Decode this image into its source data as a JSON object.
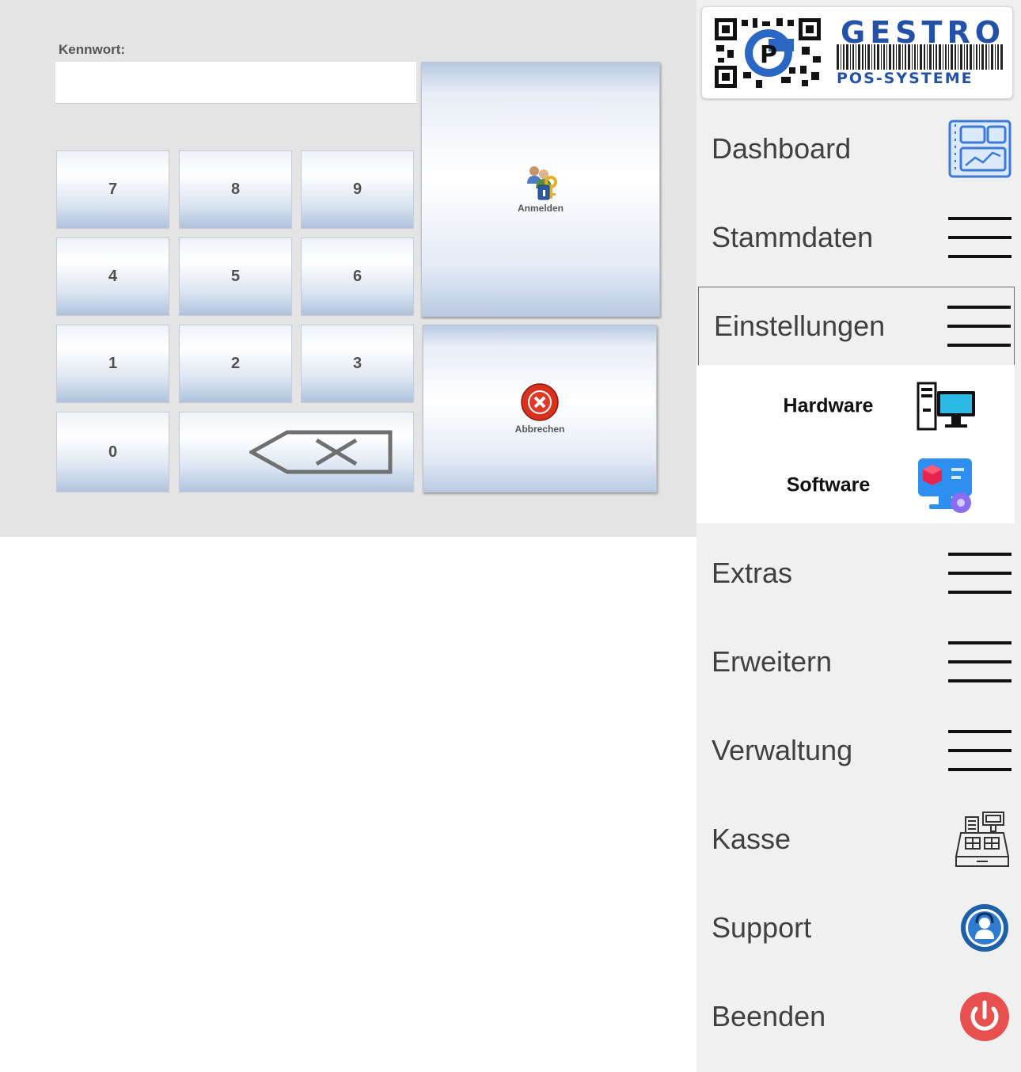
{
  "login": {
    "password_label": "Kennwort:",
    "password_value": "",
    "keys": [
      "7",
      "8",
      "9",
      "4",
      "5",
      "6",
      "1",
      "2",
      "3",
      "0"
    ],
    "login_button": "Anmelden",
    "cancel_button": "Abbrechen"
  },
  "sidebar": {
    "logo": {
      "brand": "GESTRO",
      "subtitle": "POS-SYSTEME"
    },
    "items": [
      {
        "label": "Dashboard",
        "icon": "dashboard-icon"
      },
      {
        "label": "Stammdaten",
        "icon": "hamburger-icon"
      },
      {
        "label": "Einstellungen",
        "icon": "hamburger-icon",
        "expanded": true
      },
      {
        "label": "Extras",
        "icon": "hamburger-icon"
      },
      {
        "label": "Erweitern",
        "icon": "hamburger-icon"
      },
      {
        "label": "Verwaltung",
        "icon": "hamburger-icon"
      },
      {
        "label": "Kasse",
        "icon": "cash-register-icon"
      },
      {
        "label": "Support",
        "icon": "support-icon"
      },
      {
        "label": "Beenden",
        "icon": "power-icon"
      }
    ],
    "submenu": [
      {
        "label": "Hardware",
        "icon": "computer-icon"
      },
      {
        "label": "Software",
        "icon": "software-icon"
      }
    ]
  },
  "colors": {
    "brand": "#2350a8",
    "panel": "#e4e4e4",
    "sidebar": "#f0f0f0",
    "power": "#e85050"
  }
}
